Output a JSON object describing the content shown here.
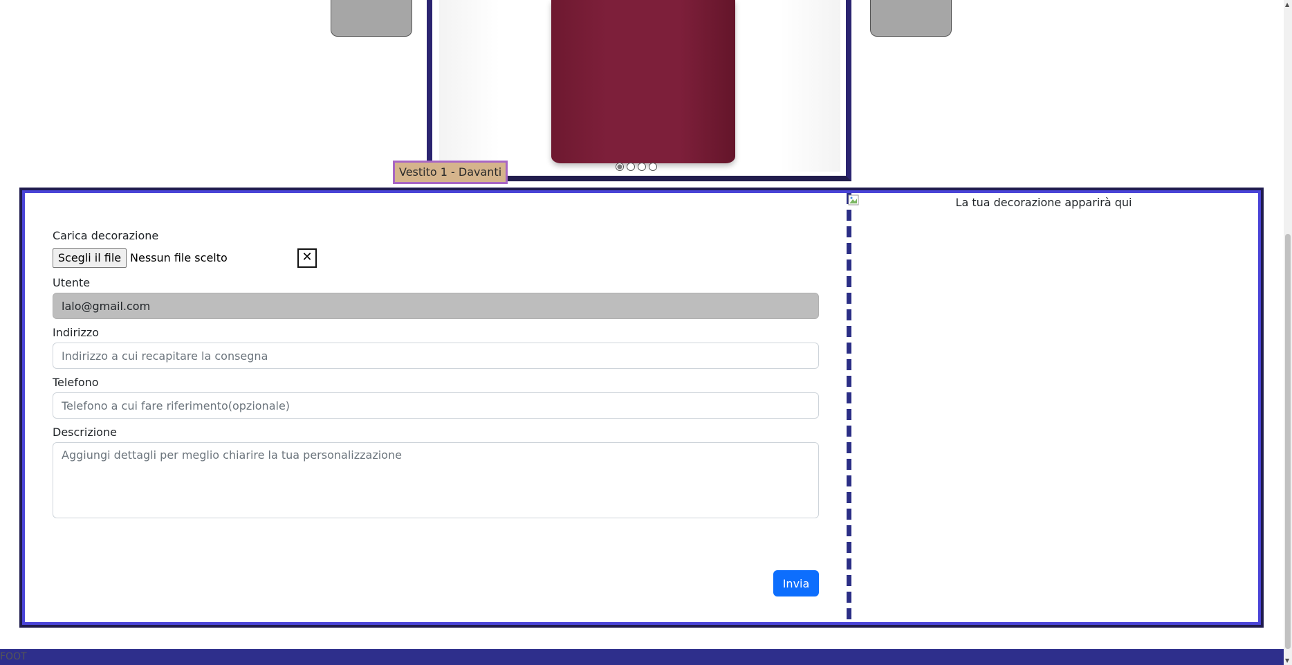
{
  "carousel": {
    "caption": "Vestito 1 - Davanti",
    "slide_count": 4,
    "active_index": 0,
    "garment_color": "#7d1f3a"
  },
  "form": {
    "upload_label": "Carica decorazione",
    "file_button_label": "Scegli il file",
    "file_status": "Nessun file scelto",
    "clear_file_label": "✕",
    "user_label": "Utente",
    "user_value": "lalo@gmail.com",
    "address_label": "Indirizzo",
    "address_placeholder": "Indirizzo a cui recapitare la consegna",
    "phone_label": "Telefono",
    "phone_placeholder": "Telefono a cui fare riferimento(opzionale)",
    "description_label": "Descrizione",
    "description_placeholder": "Aggiungi dettagli per meglio chiarire la tua personalizzazione",
    "submit_label": "Invia"
  },
  "preview": {
    "alt_text": "La tua decorazione apparirà qui"
  },
  "footer": {
    "text": "FOOT"
  },
  "colors": {
    "frame_accent": "#4a44d8",
    "frame_dark": "#1f1b4e",
    "primary_button": "#0d6efd",
    "footer_bg": "#2e2f8c",
    "caption_bg": "#d5b48c",
    "caption_border": "#a866c4"
  }
}
